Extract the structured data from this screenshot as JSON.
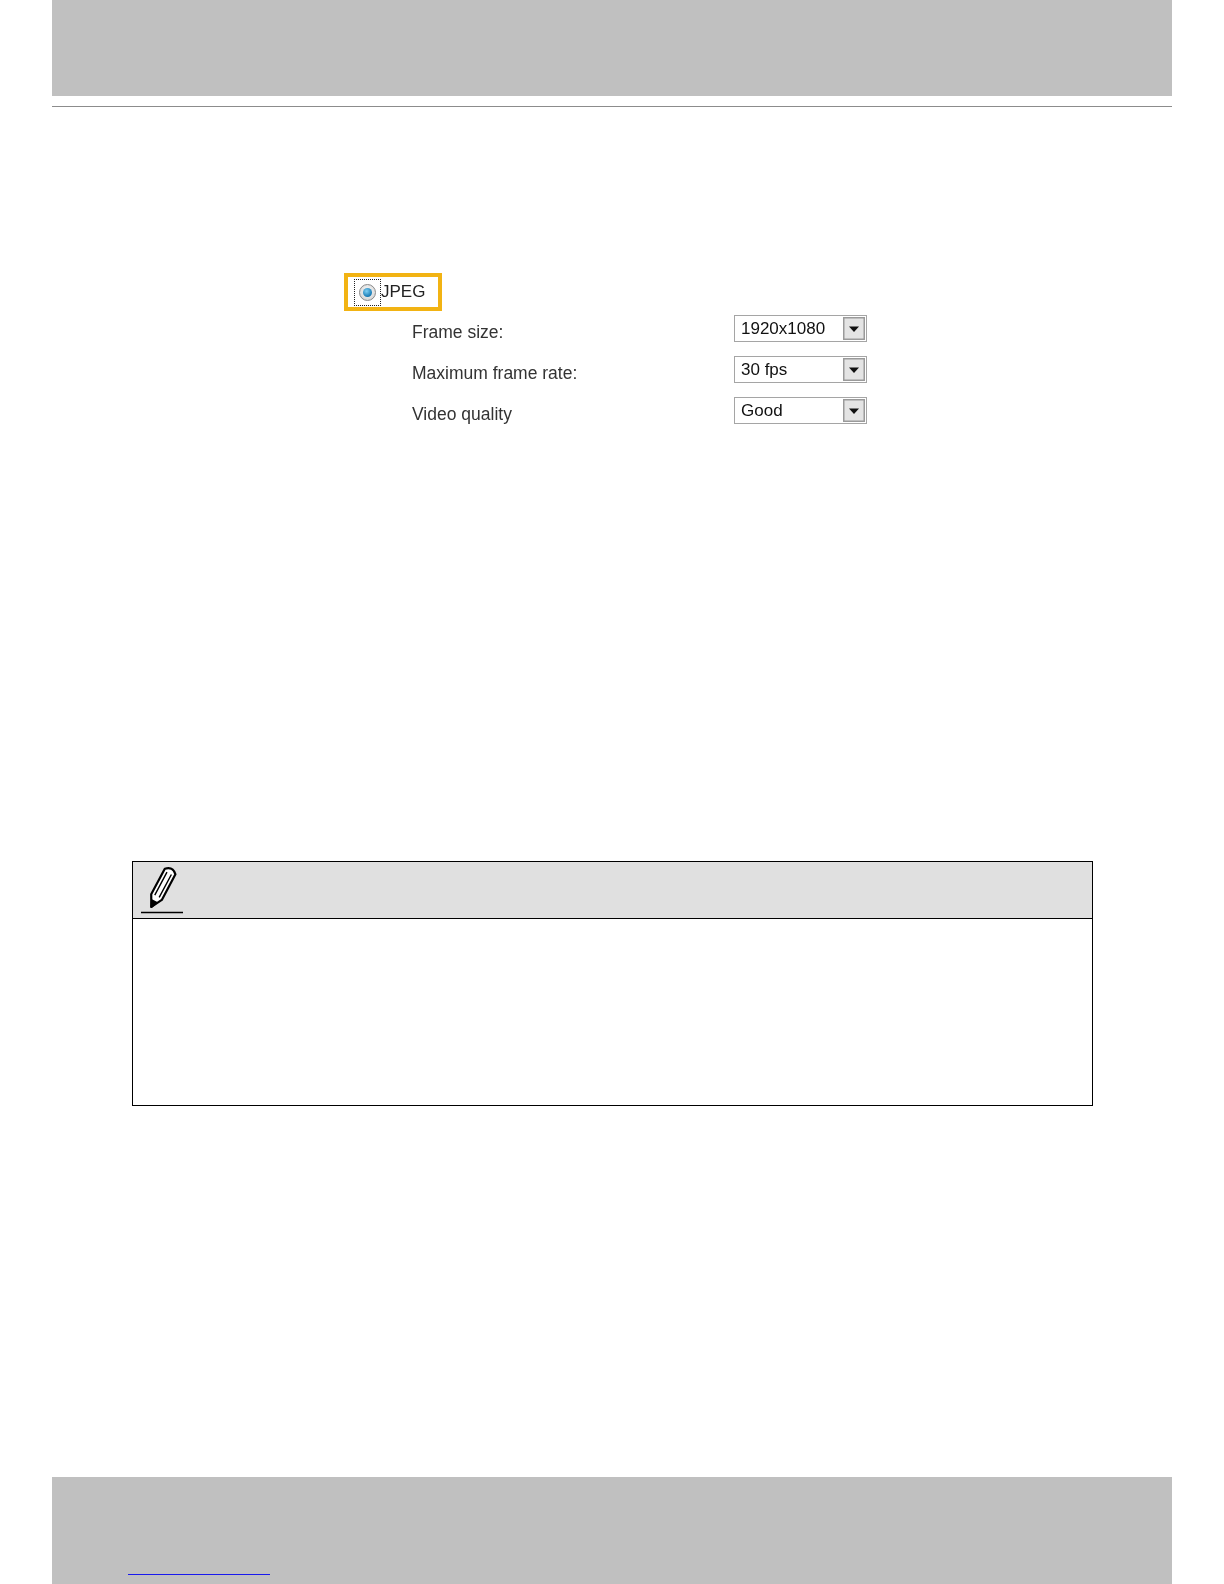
{
  "encoding_options": [
    {
      "kind": "highlighted",
      "label": "JPEG",
      "selected": true,
      "focused": true
    }
  ],
  "settings": [
    {
      "label": "Frame size:",
      "value": "1920x1080"
    },
    {
      "label": "Maximum frame rate:",
      "value": "30 fps"
    },
    {
      "label": "Video quality",
      "value": "Good"
    }
  ]
}
